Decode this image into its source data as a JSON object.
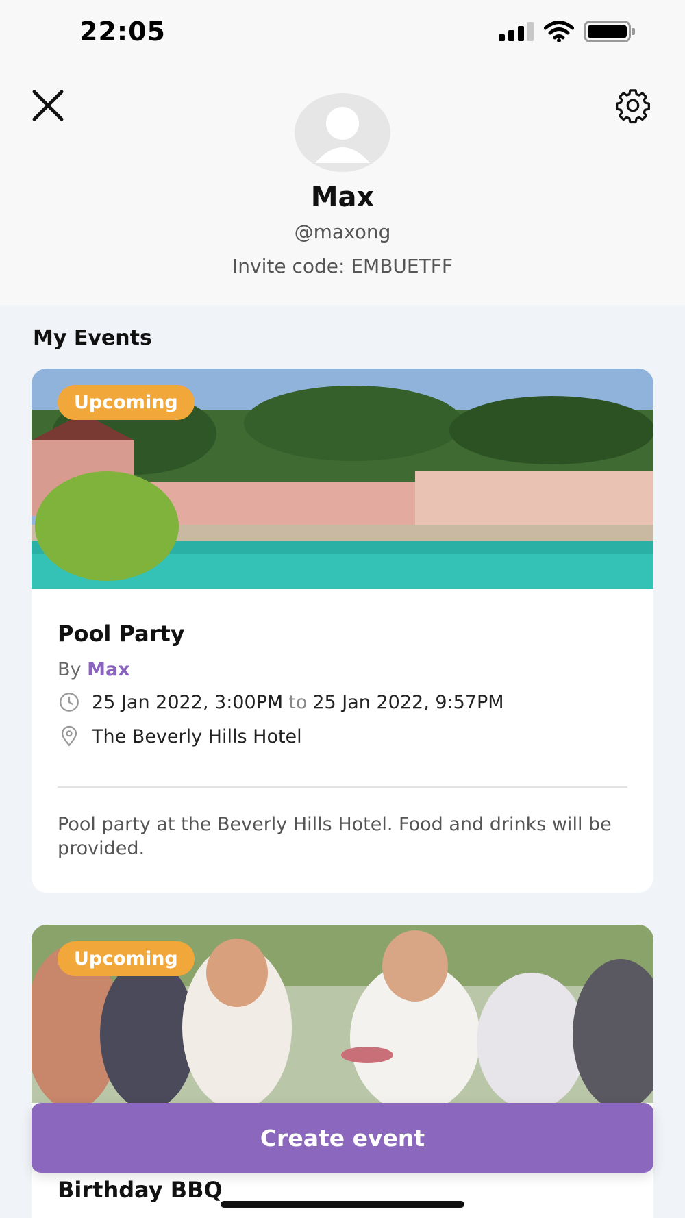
{
  "status_bar": {
    "time": "22:05"
  },
  "profile": {
    "name": "Max",
    "handle": "@maxong",
    "invite_code": "Invite code: EMBUETFF"
  },
  "section_title": "My Events",
  "events": [
    {
      "badge": "Upcoming",
      "title": "Pool Party",
      "by_label": "By",
      "host": "Max",
      "start": "25 Jan 2022, 3:00PM",
      "to_label": "to",
      "end": "25 Jan 2022, 9:57PM",
      "location": "The Beverly Hills Hotel",
      "description": "Pool party at the Beverly Hills Hotel. Food and drinks will be provided."
    },
    {
      "badge": "Upcoming",
      "title": "Birthday BBQ"
    }
  ],
  "create_button": "Create event",
  "colors": {
    "accent": "#8b68bd",
    "badge": "#f2a73a",
    "host": "#8a63bf"
  }
}
